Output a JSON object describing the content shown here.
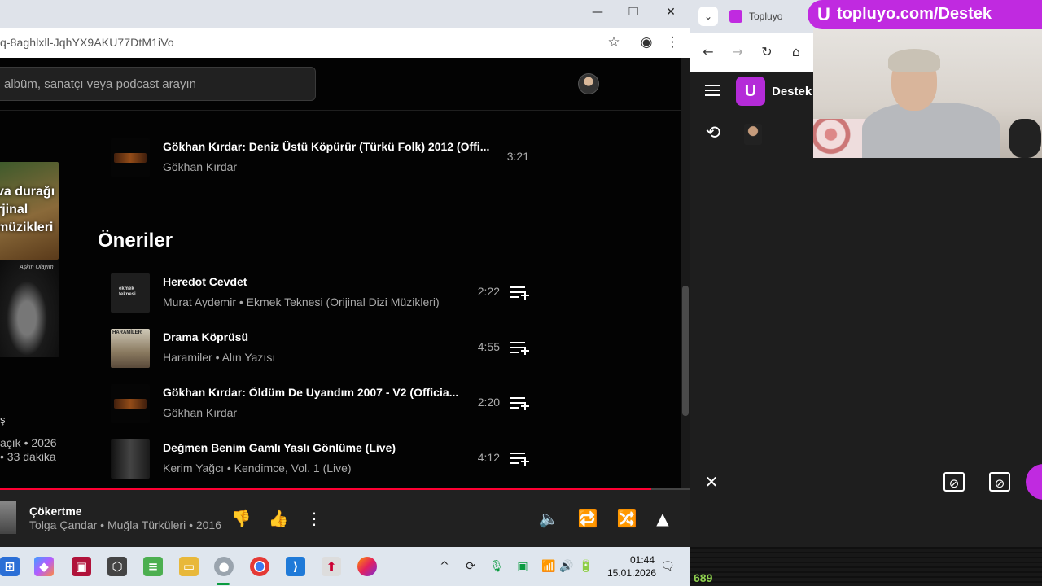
{
  "browser": {
    "url": "q-8aghlxll-JqhYX9AKU77DtM1iVo",
    "window_controls": [
      "—",
      "❐",
      "✕"
    ]
  },
  "music": {
    "search_placeholder": "albüm, sanatçı veya podcast arayın",
    "side": {
      "art_lines": [
        "va durağı",
        "rjinal",
        "müzikleri"
      ],
      "art2_caption": "Aşkın Olayım",
      "letter": "ş",
      "meta_line1": "açık • 2026",
      "meta_line2": "• 33 dakika"
    },
    "top_track": {
      "title": "Gökhan Kırdar: Deniz Üstü Köpürür (Türkü Folk) 2012 (Offi...",
      "artist": "Gökhan Kırdar",
      "duration": "3:21"
    },
    "section_title": "Öneriler",
    "recommendations": [
      {
        "title": "Heredot Cevdet",
        "subtitle": "Murat Aydemir • Ekmek Teknesi (Orijinal Dizi Müzikleri)",
        "duration": "2:22",
        "thumb_text": "ekmek teknesi"
      },
      {
        "title": "Drama Köprüsü",
        "subtitle": "Haramiler • Alın Yazısı",
        "duration": "4:55",
        "thumb_text": "HARAMİLER"
      },
      {
        "title": "Gökhan Kırdar: Öldüm De Uyandım 2007 - V2 (Officia...",
        "subtitle": "Gökhan Kırdar",
        "duration": "2:20",
        "thumb_text": ""
      },
      {
        "title": "Değmen Benim Gamlı Yaslı Gönlüme (Live)",
        "subtitle": "Kerim Yağcı • Kendimce, Vol. 1 (Live)",
        "duration": "4:12",
        "thumb_text": ""
      }
    ],
    "now_playing": {
      "title": "Çökertme",
      "subtitle": "Tolga Çandar • Muğla Türküleri • 2016",
      "progress": 0.943
    }
  },
  "taskbar": {
    "time": "01:44",
    "date": "15.01.2026"
  },
  "right_panel": {
    "tab_title": "Topluyo",
    "app_name": "Destek",
    "promo_text": "topluyo.com/Destek",
    "counter": "689"
  },
  "colors": {
    "accent": "#ff0033",
    "brand": "#c02ae0"
  }
}
